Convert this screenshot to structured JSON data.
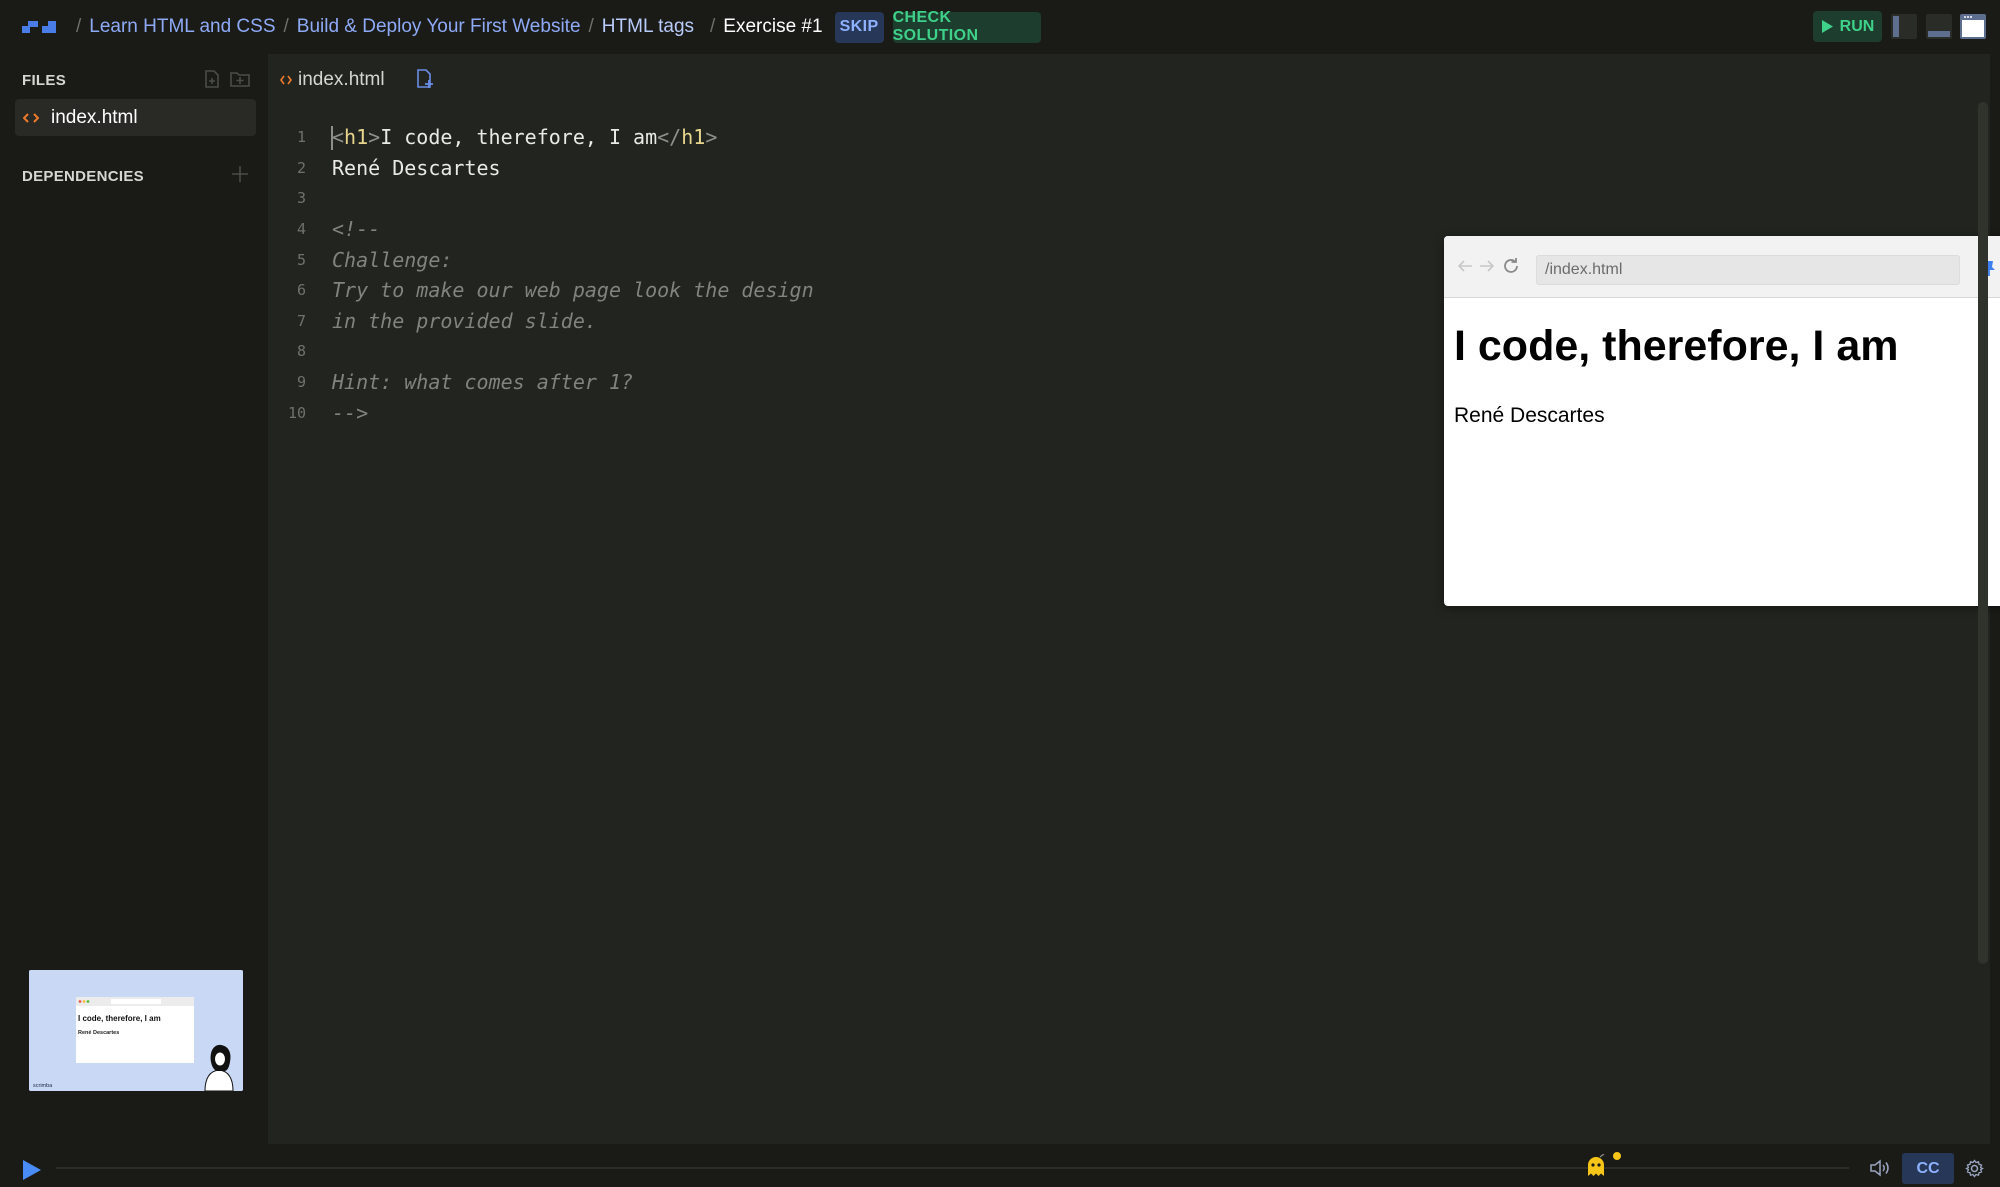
{
  "breadcrumb": {
    "items": [
      "Learn HTML and CSS",
      "Build & Deploy Your First Website",
      "HTML tags"
    ],
    "current": "Exercise #1",
    "separator": "/"
  },
  "toolbar": {
    "skip_label": "SKIP",
    "check_solution_label": "CHECK SOLUTION",
    "run_label": "RUN"
  },
  "sidebar": {
    "files_heading": "FILES",
    "files": [
      {
        "name": "index.html",
        "icon": "code-icon",
        "selected": true
      }
    ],
    "dependencies_heading": "DEPENDENCIES"
  },
  "editor": {
    "tab_label": "index.html",
    "lines": [
      {
        "n": "1"
      },
      {
        "n": "2",
        "text": "René Descartes"
      },
      {
        "n": "3",
        "text": ""
      },
      {
        "n": "4",
        "text": "<!--"
      },
      {
        "n": "5",
        "text": "Challenge:"
      },
      {
        "n": "6",
        "text": "Try to make our web page look the design"
      },
      {
        "n": "7",
        "text": "in the provided slide."
      },
      {
        "n": "8",
        "text": ""
      },
      {
        "n": "9",
        "text": "Hint: what comes after 1?"
      },
      {
        "n": "10",
        "text": "-->"
      }
    ],
    "line1": {
      "open_lt": "<",
      "open_tag": "h1",
      "open_gt": ">",
      "content": "I code, therefore, I am",
      "close_lt": "</",
      "close_tag": "h1",
      "close_gt": ">"
    }
  },
  "preview": {
    "url": "/index.html",
    "heading": "I code, therefore, I am",
    "paragraph": "René Descartes"
  },
  "slide_thumbnail": {
    "heading": "I code, therefore, I am",
    "paragraph": "René Descartes",
    "brand": "scrimba"
  },
  "player": {
    "cc_label": "CC"
  },
  "colors": {
    "background": "#1a1b17",
    "editor_background": "#22241f",
    "link": "#8eaaf6",
    "skip_bg": "#273757",
    "check_bg": "#1d3d2e",
    "check_fg": "#3fd089",
    "play": "#4a8cf7",
    "notification": "#f5c518"
  }
}
